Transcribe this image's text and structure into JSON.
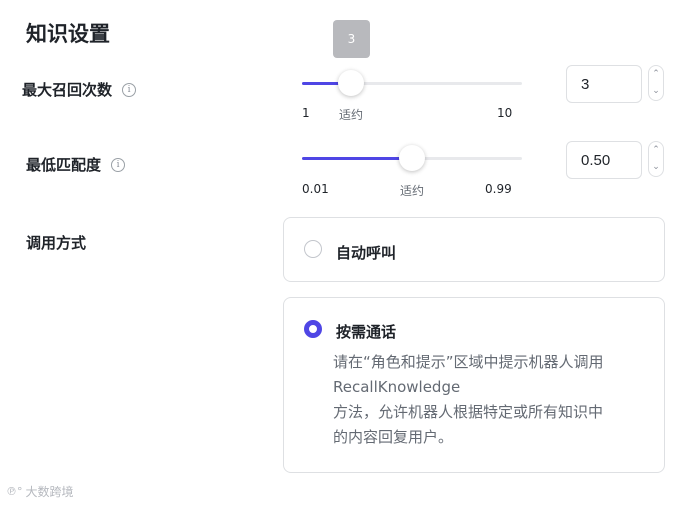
{
  "section_title": "知识设置",
  "max_recall": {
    "label": "最大召回次数",
    "tooltip": "3",
    "min_label": "1",
    "mid_label": "适约",
    "max_label": "10",
    "value": "3",
    "level": 0.222
  },
  "min_match": {
    "label": "最低匹配度",
    "min_label": "0.01",
    "mid_label": "适约",
    "max_label": "0.99",
    "value": "0.50",
    "level": 0.5
  },
  "stepper": {
    "up": "⌃",
    "down": "⌄"
  },
  "info_glyph": "i",
  "call_mode": {
    "label": "调用方式",
    "options": [
      {
        "title": "自动呼叫",
        "checked": false
      },
      {
        "title": "按需通话",
        "checked": true,
        "desc_1": "请在“角色和提示”区域中提示机器人调用",
        "desc_2": "RecallKnowledge",
        "desc_3": "方法，允许机器人根据特定或所有知识中",
        "desc_4": "的内容回复用户。"
      }
    ]
  },
  "watermark": "大数跨境",
  "colors": {
    "accent": "#4f46e5",
    "track": "#e8e9ec",
    "border": "#dee0e3"
  }
}
